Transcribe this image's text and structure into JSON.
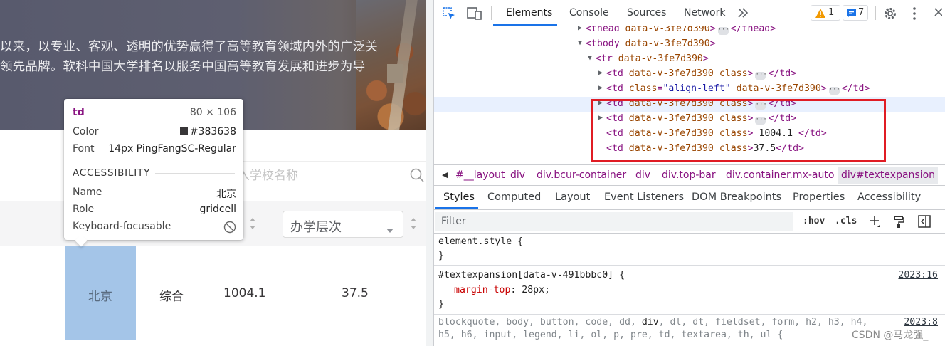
{
  "page": {
    "hero_line1": "以来，以专业、客观、透明的优势赢得了高等教育领域内外的广泛关",
    "hero_line2": "领先品牌。软科中国大学排名以服务中国高等教育发展和进步为导",
    "search_placeholder": "入学校名称",
    "level_select_value": "办学层次",
    "row": {
      "province": "北京",
      "type": "综合",
      "score": "1004.1",
      "level_score": "37.5"
    }
  },
  "inspector": {
    "tag": "td",
    "size": "80 × 106",
    "color_label": "Color",
    "color_value": "#383638",
    "font_label": "Font",
    "font_value": "14px PingFangSC-Regular",
    "accessibility_heading": "ACCESSIBILITY",
    "name_label": "Name",
    "name_value": "北京",
    "role_label": "Role",
    "role_value": "gridcell",
    "keyboard_label": "Keyboard-focusable"
  },
  "devtools": {
    "tabs": [
      "Elements",
      "Console",
      "Sources",
      "Network"
    ],
    "warning_count": "1",
    "message_count": "7",
    "dom": {
      "thead_open": "<thead",
      "thead_attr": "data-v-3fe7d390",
      "thead_close": "</thead>",
      "tbody_open": "<tbody",
      "tbody_attr": "data-v-3fe7d390",
      "tbody_close": ">",
      "tr_open": "<tr",
      "tr_attr": "data-v-3fe7d390",
      "tr_close": ">",
      "td_open": "<td",
      "td_attr": "data-v-3fe7d390",
      "td_class": "class",
      "td_close": ">",
      "td_end": "</td>",
      "td_class_eq": "=",
      "align_left_val": "\"align-left\"",
      "text_1004": " 1004.1 ",
      "text_375": "37.5"
    },
    "breadcrumbs": [
      "#__layout",
      "div",
      "div.bcur-container",
      "div",
      "div.top-bar",
      "div.container.mx-auto",
      "div#textexpansion"
    ],
    "sub_tabs": [
      "Styles",
      "Computed",
      "Layout",
      "Event Listeners",
      "DOM Breakpoints",
      "Properties",
      "Accessibility"
    ],
    "filter_placeholder": "Filter",
    "hov": ":hov",
    "cls": ".cls",
    "styles": {
      "element_style": "element.style {",
      "close_brace": "}",
      "rule1_selector": "#textexpansion[data-v-491bbbc0] {",
      "rule1_source": "2023:16",
      "rule1_prop": "margin-top",
      "rule1_value": "28px;",
      "rule2_selector_a": "blockquote, body, button, code, dd, ",
      "rule2_selector_div": "div",
      "rule2_selector_b": ", dl, dt, fieldset, form, h2, h3, h4,",
      "rule2_selector_line2": "h5, h6, input, legend, li, ol, p, pre, td, textarea, th, ul {",
      "rule2_source": "2023:8"
    }
  },
  "watermark": "CSDN @马龙强_",
  "colors": {
    "accent": "#1a73e8",
    "highlight_cell": "#a4c5e8",
    "red_box": "#e01c24"
  }
}
